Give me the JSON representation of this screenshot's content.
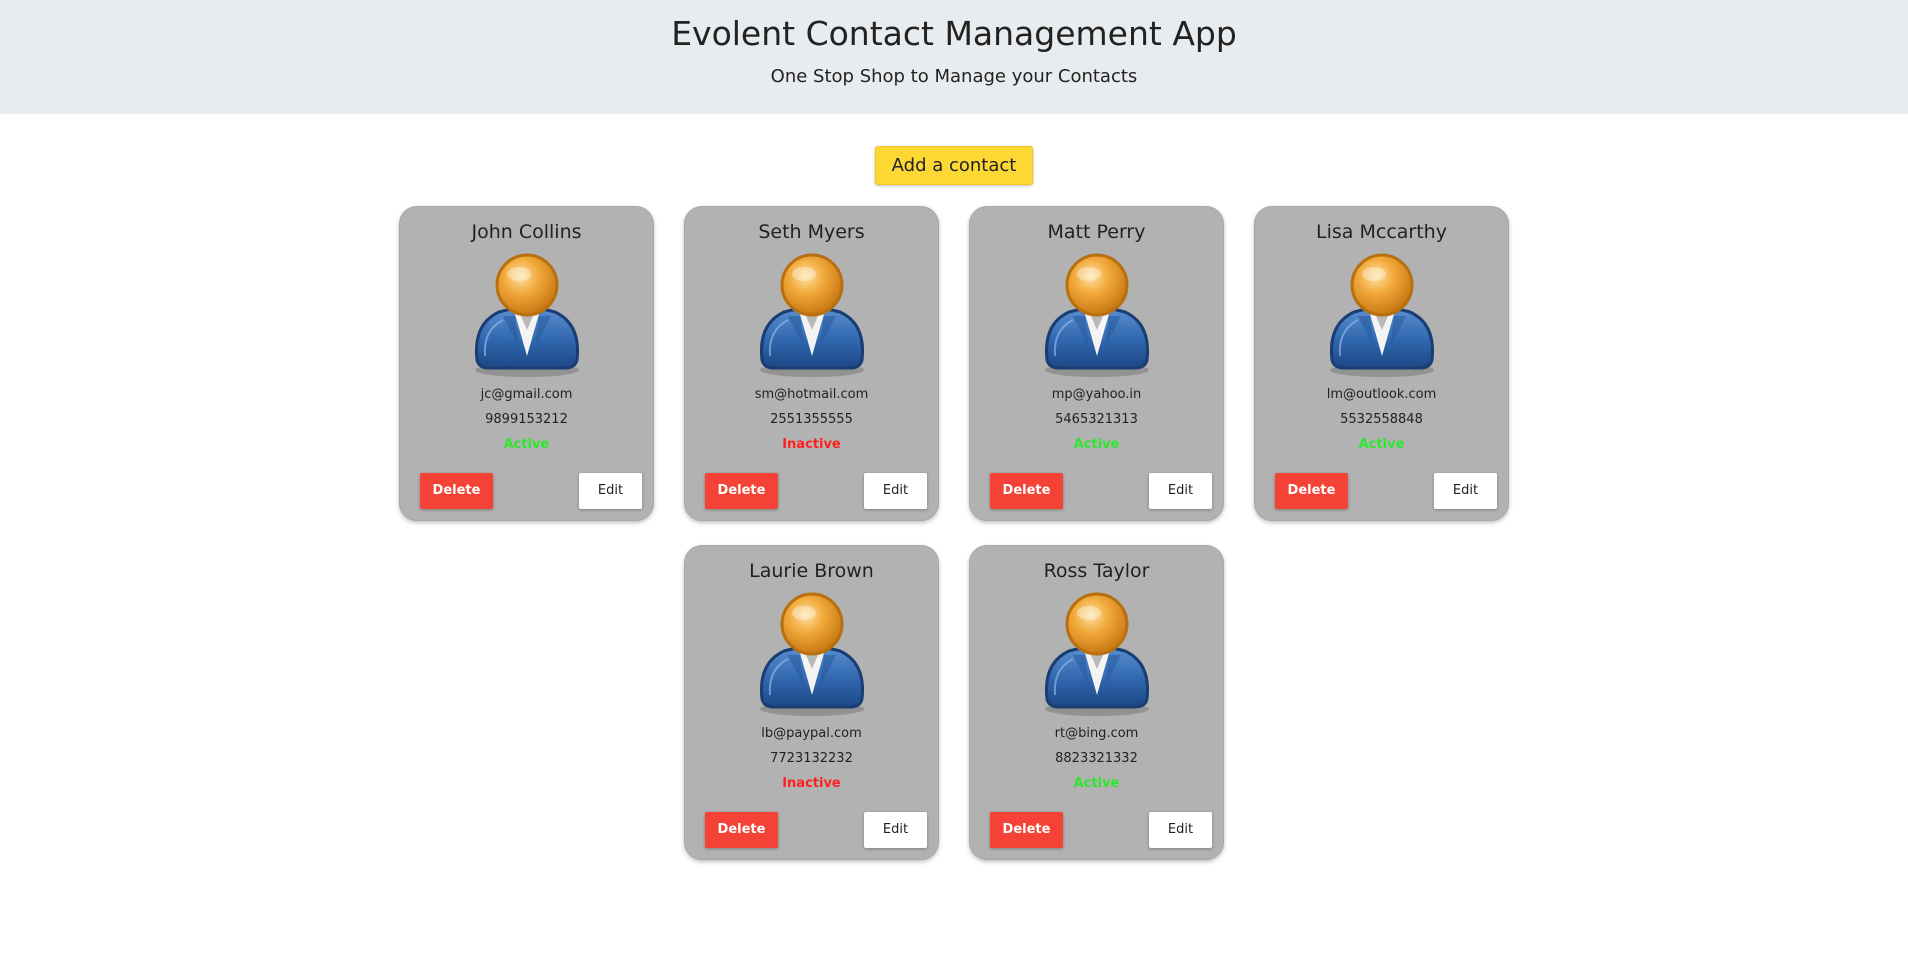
{
  "header": {
    "title": "Evolent Contact Management App",
    "subtitle": "One Stop Shop to Manage your Contacts"
  },
  "actions": {
    "add_label": "Add a contact"
  },
  "contacts": [
    {
      "name": "John Collins",
      "email": "jc@gmail.com",
      "phone": "9899153212",
      "status": "Active",
      "avatar": "person-avatar-icon",
      "delete_label": "Delete",
      "edit_label": "Edit"
    },
    {
      "name": "Seth Myers",
      "email": "sm@hotmail.com",
      "phone": "2551355555",
      "status": "Inactive",
      "avatar": "person-avatar-icon",
      "delete_label": "Delete",
      "edit_label": "Edit"
    },
    {
      "name": "Matt Perry",
      "email": "mp@yahoo.in",
      "phone": "5465321313",
      "status": "Active",
      "avatar": "person-avatar-icon",
      "delete_label": "Delete",
      "edit_label": "Edit"
    },
    {
      "name": "Lisa Mccarthy",
      "email": "lm@outlook.com",
      "phone": "5532558848",
      "status": "Active",
      "avatar": "person-avatar-icon",
      "delete_label": "Delete",
      "edit_label": "Edit"
    },
    {
      "name": "Laurie Brown",
      "email": "lb@paypal.com",
      "phone": "7723132232",
      "status": "Inactive",
      "avatar": "person-avatar-icon",
      "delete_label": "Delete",
      "edit_label": "Edit"
    },
    {
      "name": "Ross Taylor",
      "email": "rt@bing.com",
      "phone": "8823321332",
      "status": "Active",
      "avatar": "person-avatar-icon",
      "delete_label": "Delete",
      "edit_label": "Edit"
    }
  ],
  "colors": {
    "header_bg": "#e9ecef",
    "add_button": "#fdd835",
    "card_bg": "#b2b2b2",
    "delete_button": "#f44336",
    "status_active": "#2ee62e",
    "status_inactive": "#ff1f1f"
  }
}
